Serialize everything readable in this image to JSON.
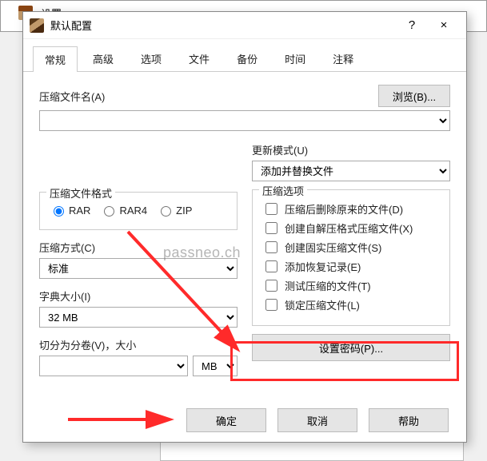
{
  "bg_window": {
    "title": "设置"
  },
  "dialog": {
    "title": "默认配置",
    "help": "?",
    "close": "×"
  },
  "tabs": [
    "常规",
    "高级",
    "选项",
    "文件",
    "备份",
    "时间",
    "注释"
  ],
  "archive_name_label": "压缩文件名(A)",
  "browse_label": "浏览(B)...",
  "update_mode_label": "更新模式(U)",
  "update_mode_value": "添加并替换文件",
  "format_group": "压缩文件格式",
  "formats": {
    "rar": "RAR",
    "rar4": "RAR4",
    "zip": "ZIP"
  },
  "method_label": "压缩方式(C)",
  "method_value": "标准",
  "dict_label": "字典大小(I)",
  "dict_value": "32 MB",
  "split_label": "切分为分卷(V)，大小",
  "split_unit": "MB",
  "options_group": "压缩选项",
  "options": [
    "压缩后删除原来的文件(D)",
    "创建自解压格式压缩文件(X)",
    "创建固实压缩文件(S)",
    "添加恢复记录(E)",
    "测试压缩的文件(T)",
    "锁定压缩文件(L)"
  ],
  "set_password": "设置密码(P)...",
  "footer": {
    "ok": "确定",
    "cancel": "取消",
    "help": "帮助"
  },
  "watermark": "passneo.ch"
}
